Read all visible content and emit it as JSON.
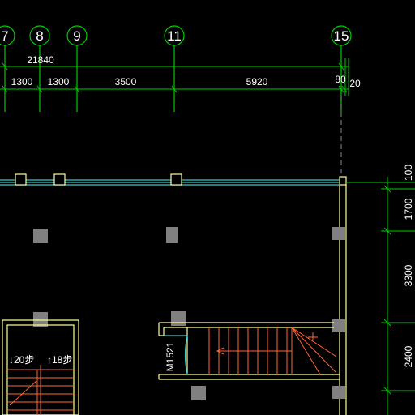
{
  "axes": {
    "grid_7": "7",
    "grid_8": "8",
    "grid_9": "9",
    "grid_11": "11",
    "grid_15": "15"
  },
  "dimensions_top": {
    "total": "21840",
    "seg_1": "1300",
    "seg_2": "1300",
    "seg_3": "3500",
    "seg_4": "5920",
    "seg_5": "80",
    "seg_6": "20"
  },
  "dimensions_right": {
    "d1": "100",
    "d2": "1700",
    "d3": "3300",
    "d4": "2400"
  },
  "stair_left": {
    "down_label": "↓20步",
    "up_label": "↑18步"
  },
  "door": {
    "tag": "M1521"
  },
  "colors": {
    "background": "#000000",
    "dimension_green": "#00cc00",
    "wall_yellow": "#ffff99",
    "wall_cyan": "#33cccc",
    "stair_orange": "#ff6633",
    "column_gray": "#808080",
    "text_white": "#ffffff"
  }
}
